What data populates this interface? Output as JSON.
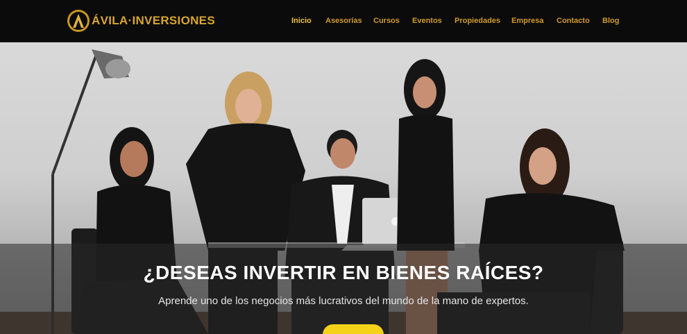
{
  "brand": {
    "name": "ÁVILA·INVERSIONES",
    "accent_color": "#d9a62e",
    "logo_icon": "gold-a-monogram"
  },
  "nav": {
    "items": [
      {
        "label": "Inicio",
        "active": true
      },
      {
        "label": "Asesorías",
        "active": false
      },
      {
        "label": "Cursos",
        "active": false
      },
      {
        "label": "Eventos",
        "active": false
      },
      {
        "label": "Propiedades",
        "active": false
      },
      {
        "label": "Empresa",
        "active": false
      },
      {
        "label": "Contacto",
        "active": false
      },
      {
        "label": "Blog",
        "active": false
      }
    ]
  },
  "hero": {
    "title": "¿DESEAS INVERTIR EN BIENES RAÍCES?",
    "subtitle": "Aprende uno de los negocios más lucrativos del mundo de la mano de expertos.",
    "button_color": "#f5d21a"
  }
}
